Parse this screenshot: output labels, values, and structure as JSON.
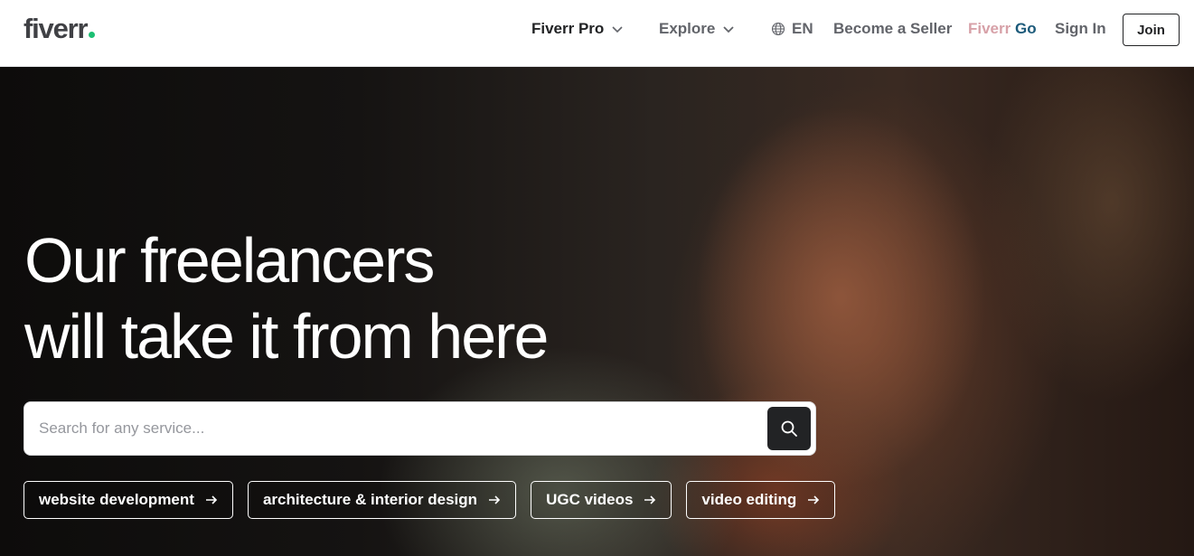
{
  "header": {
    "logo_text": "fiverr",
    "nav": {
      "fiverr_pro": "Fiverr Pro",
      "explore": "Explore",
      "language": "EN",
      "become_seller": "Become a Seller",
      "fiverr_go_brand": "Fiverr",
      "fiverr_go_suffix": " Go",
      "sign_in": "Sign In",
      "join": "Join"
    }
  },
  "hero": {
    "title_line1": "Our freelancers",
    "title_line2": "will take it from here",
    "search": {
      "placeholder": "Search for any service..."
    },
    "chips": [
      {
        "label": "website development"
      },
      {
        "label": "architecture & interior design"
      },
      {
        "label": "UGC videos"
      },
      {
        "label": "video editing"
      }
    ]
  },
  "colors": {
    "brand_green": "#1dbf73",
    "text_dark": "#222325",
    "text_gray": "#62646a"
  },
  "icons": [
    "chevron-down-icon",
    "globe-icon",
    "search-icon",
    "arrow-right-icon"
  ]
}
